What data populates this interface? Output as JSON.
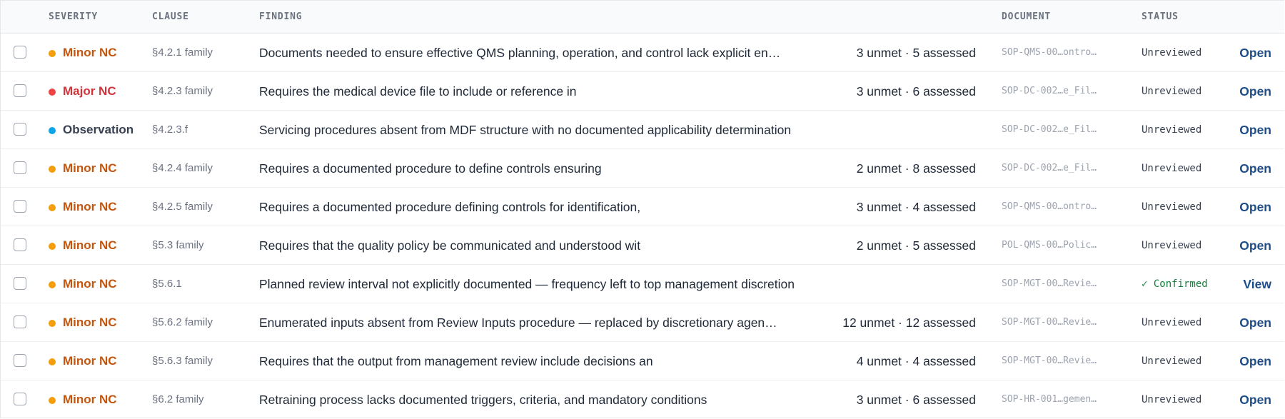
{
  "header": {
    "severity": "SEVERITY",
    "clause": "CLAUSE",
    "finding": "FINDING",
    "document": "DOCUMENT",
    "status": "STATUS"
  },
  "colors": {
    "minor": "#c2560f",
    "minor_dot": "#f59e0b",
    "major": "#d1343a",
    "major_dot": "#ef4444",
    "observation": "#374151",
    "observation_dot": "#0ea5e9",
    "action": "#1d4e89",
    "confirmed": "#15803d"
  },
  "rows": [
    {
      "severity": "Minor NC",
      "level": "minor",
      "clause": "§4.2.1 family",
      "finding": "Documents needed to ensure effective QMS planning, operation, and control lack explicit en…",
      "counts": "3 unmet · 5 assessed",
      "document": "SOP-QMS-00…ontro…",
      "status": "Unreviewed",
      "action": "Open"
    },
    {
      "severity": "Major NC",
      "level": "major",
      "clause": "§4.2.3 family",
      "finding": "Requires the medical device file to include or reference in",
      "counts": "3 unmet · 6 assessed",
      "document": "SOP-DC-002…e_Fil…",
      "status": "Unreviewed",
      "action": "Open"
    },
    {
      "severity": "Observation",
      "level": "observation",
      "clause": "§4.2.3.f",
      "finding": "Servicing procedures absent from MDF structure with no documented applicability determination",
      "counts": "",
      "document": "SOP-DC-002…e_Fil…",
      "status": "Unreviewed",
      "action": "Open"
    },
    {
      "severity": "Minor NC",
      "level": "minor",
      "clause": "§4.2.4 family",
      "finding": "Requires a documented procedure to define controls ensuring",
      "counts": "2 unmet · 8 assessed",
      "document": "SOP-DC-002…e_Fil…",
      "status": "Unreviewed",
      "action": "Open"
    },
    {
      "severity": "Minor NC",
      "level": "minor",
      "clause": "§4.2.5 family",
      "finding": "Requires a documented procedure defining controls for identification,",
      "counts": "3 unmet · 4 assessed",
      "document": "SOP-QMS-00…ontro…",
      "status": "Unreviewed",
      "action": "Open"
    },
    {
      "severity": "Minor NC",
      "level": "minor",
      "clause": "§5.3 family",
      "finding": "Requires that the quality policy be communicated and understood wit",
      "counts": "2 unmet · 5 assessed",
      "document": "POL-QMS-00…Polic…",
      "status": "Unreviewed",
      "action": "Open"
    },
    {
      "severity": "Minor NC",
      "level": "minor",
      "clause": "§5.6.1",
      "finding": "Planned review interval not explicitly documented — frequency left to top management discretion",
      "counts": "",
      "document": "SOP-MGT-00…Revie…",
      "status": "✓ Confirmed",
      "confirmed": true,
      "action": "View"
    },
    {
      "severity": "Minor NC",
      "level": "minor",
      "clause": "§5.6.2 family",
      "finding": "Enumerated inputs absent from Review Inputs procedure — replaced by discretionary agen…",
      "counts": "12 unmet · 12 assessed",
      "document": "SOP-MGT-00…Revie…",
      "status": "Unreviewed",
      "action": "Open"
    },
    {
      "severity": "Minor NC",
      "level": "minor",
      "clause": "§5.6.3 family",
      "finding": "Requires that the output from management review include decisions an",
      "counts": "4 unmet · 4 assessed",
      "document": "SOP-MGT-00…Revie…",
      "status": "Unreviewed",
      "action": "Open"
    },
    {
      "severity": "Minor NC",
      "level": "minor",
      "clause": "§6.2 family",
      "finding": "Retraining process lacks documented triggers, criteria, and mandatory conditions",
      "counts": "3 unmet · 6 assessed",
      "document": "SOP-HR-001…gemen…",
      "status": "Unreviewed",
      "action": "Open"
    }
  ]
}
